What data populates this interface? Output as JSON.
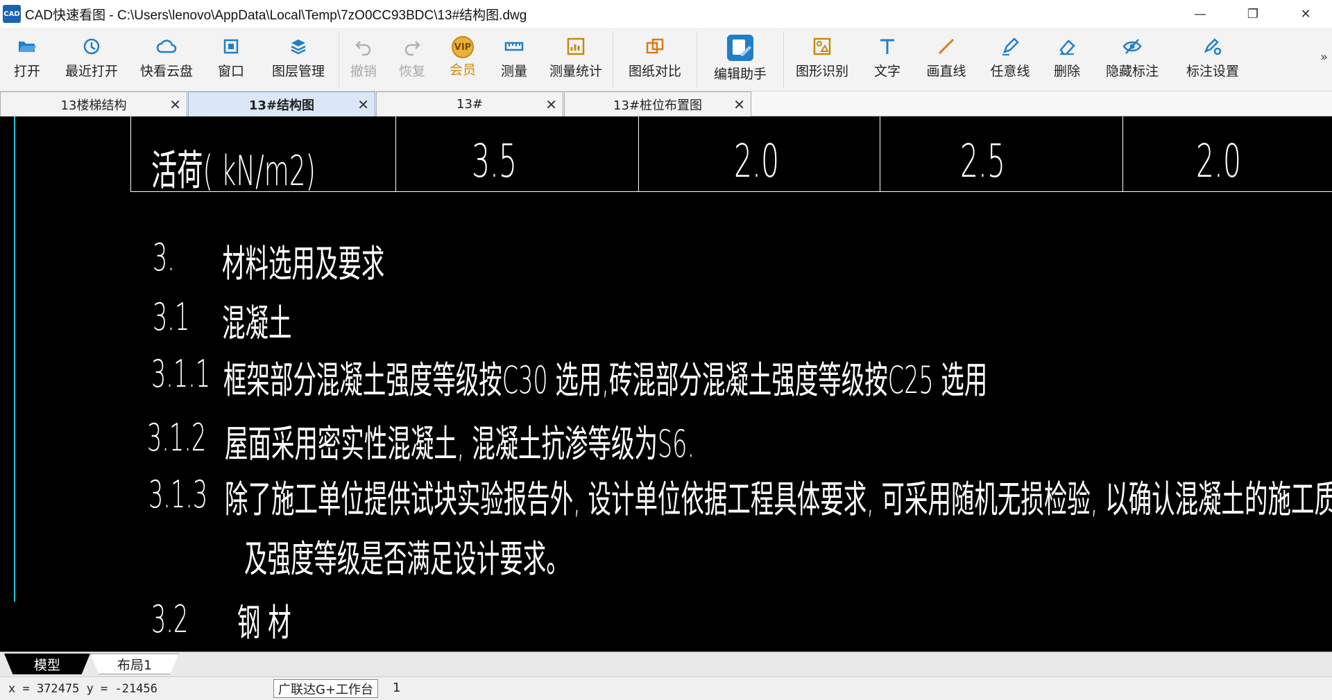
{
  "window": {
    "logo": "CAD",
    "title": "CAD快速看图 - C:\\Users\\lenovo\\AppData\\Local\\Temp\\7zO0CC93BDC\\13#结构图.dwg",
    "minimize": "—",
    "restore": "❐",
    "close": "✕"
  },
  "toolbar": {
    "open": "打开",
    "recent": "最近打开",
    "cloud": "快看云盘",
    "window": "窗口",
    "layers": "图层管理",
    "undo": "撤销",
    "redo": "恢复",
    "vip": "会员",
    "vip_badge": "VIP",
    "measure": "测量",
    "measure_stats": "测量统计",
    "compare": "图纸对比",
    "edit_helper": "编辑助手",
    "shape_recog": "图形识别",
    "text": "文字",
    "line": "画直线",
    "freehand": "任意线",
    "delete": "删除",
    "hide_marks": "隐藏标注",
    "mark_settings": "标注设置",
    "more": "»",
    "accent": "#1f7fc8"
  },
  "tabs": [
    {
      "label": "13楼梯结构",
      "close": "✕"
    },
    {
      "label": "13#结构图",
      "close": "✕"
    },
    {
      "label": "13#",
      "close": "✕"
    },
    {
      "label": "13#桩位布置图",
      "close": "✕"
    }
  ],
  "drawing": {
    "table_label": "活荷( kN/m2)",
    "values": [
      "3.5",
      "2.0",
      "2.5",
      "2.0"
    ],
    "lines": [
      {
        "num": "3.",
        "text": "材料选用及要求"
      },
      {
        "num": "3.1",
        "text": "混凝土"
      },
      {
        "num": "3.1.1",
        "text": "框架部分混凝土强度等级按C30 选用,砖混部分混凝土强度等级按C25 选用"
      },
      {
        "num": "3.1.2",
        "text": "屋面采用密实性混凝土, 混凝土抗渗等级为S6."
      },
      {
        "num": "3.1.3",
        "text": "除了施工单位提供试块实验报告外, 设计单位依据工程具体要求, 可采用随机无损检验, 以确认混凝土的施工质量及"
      },
      {
        "num": "",
        "text": "及强度等级是否满足设计要求。"
      },
      {
        "num": "3.2",
        "text": "钢  材"
      }
    ]
  },
  "layout_tabs": {
    "model": "模型",
    "layout1": "布局1"
  },
  "status": {
    "coords": "x = 372475  y = -21456",
    "button": "广联达G+工作台",
    "extra": "1"
  }
}
